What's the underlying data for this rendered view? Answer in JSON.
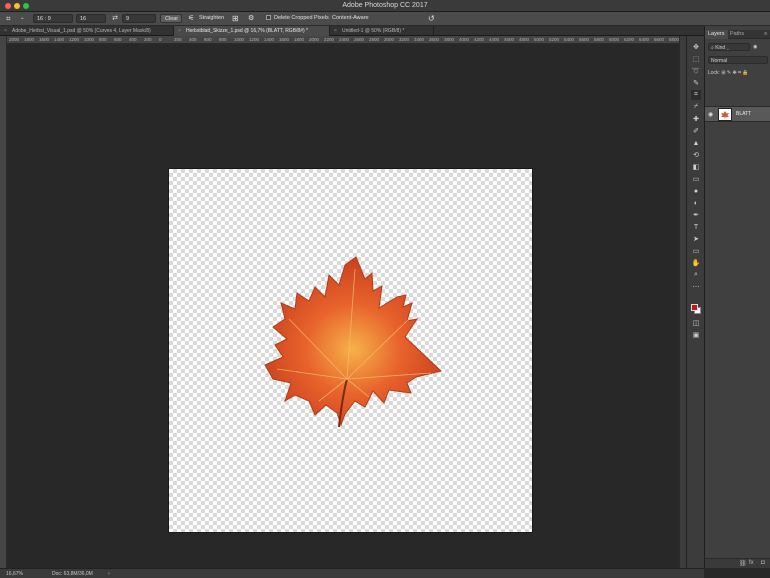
{
  "app": {
    "title": "Adobe Photoshop CC 2017"
  },
  "window_controls": {
    "close": "#ff5f57",
    "minimize": "#febc2e",
    "zoom": "#28c840"
  },
  "options_bar": {
    "ratio_preset": "16 : 9",
    "ratio_width": "16",
    "ratio_height": "9",
    "clear_label": "Clear",
    "straighten_label": "Straighten",
    "delete_cropped_label": "Delete Cropped Pixels",
    "content_aware_label": "Content-Aware"
  },
  "tabs": [
    {
      "label": "Adobe_Herbst_Visual_1.psd @ 50% (Curves 4, Layer Mask/8)"
    },
    {
      "label": "Herbstblatt_Skizze_1.psd @ 16,7% (BLATT, RGB/8#) *"
    },
    {
      "label": "Untitled-1 @ 50% (RGB/8) *"
    }
  ],
  "ruler_h": [
    "2000",
    "1800",
    "1600",
    "1400",
    "1200",
    "1000",
    "800",
    "600",
    "400",
    "200",
    "0",
    "200",
    "400",
    "600",
    "800",
    "1000",
    "1200",
    "1400",
    "1600",
    "1800",
    "2000",
    "2200",
    "2400",
    "2600",
    "2800",
    "3000",
    "3200",
    "3400",
    "3600",
    "3800",
    "4000",
    "4200",
    "4400",
    "4600",
    "4800",
    "5000",
    "5200",
    "5400",
    "5600",
    "5800",
    "6000",
    "6200",
    "6400",
    "6600",
    "6800",
    "7000"
  ],
  "panel": {
    "tab_layers": "Layers",
    "tab_paths": "Paths",
    "kind_label": "Kind",
    "blend_mode": "Normal",
    "lock_label": "Lock:",
    "layer_name": "BLATT"
  },
  "status": {
    "zoom": "16,67%",
    "doc": "Doc: 63,8M/36,0M"
  },
  "colors": {
    "foreground": "#c8151c",
    "background": "#ffffff",
    "leaf_primary": "#e0542a",
    "leaf_highlight": "#f29a3a",
    "leaf_dark": "#b8301a"
  }
}
